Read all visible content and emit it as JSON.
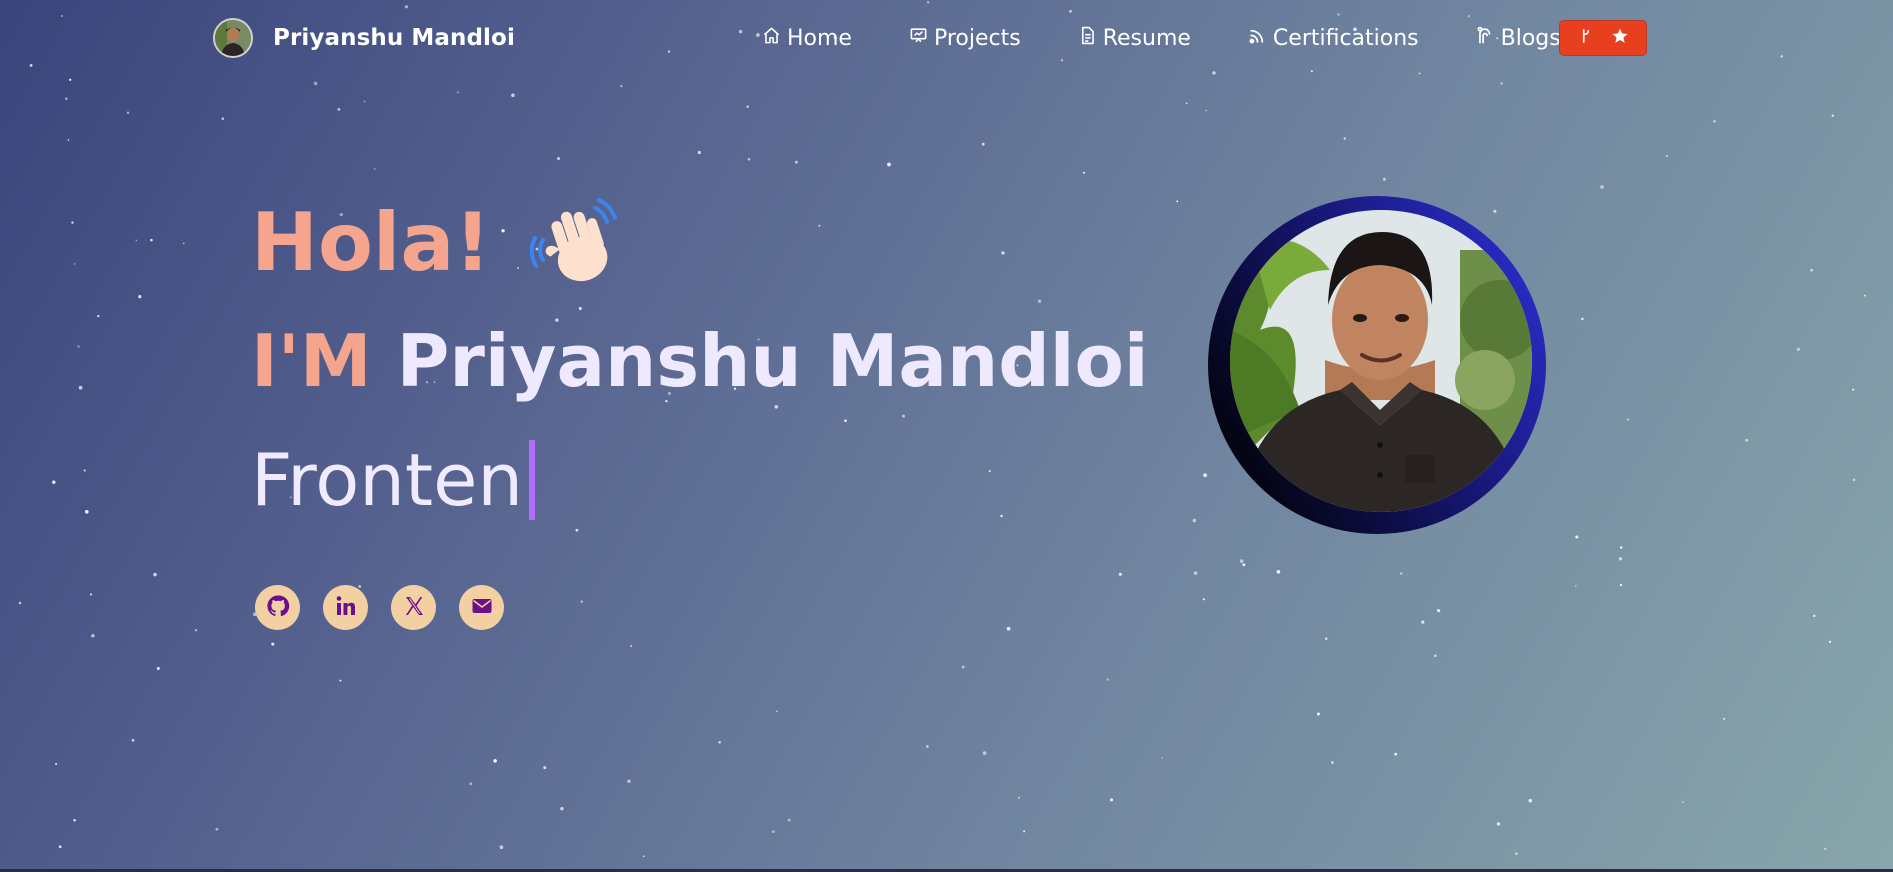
{
  "navbar": {
    "brand_name": "Priyanshu Mandloi",
    "links": [
      {
        "label": "Home",
        "icon": "home-icon"
      },
      {
        "label": "Projects",
        "icon": "presentation-icon"
      },
      {
        "label": "Resume",
        "icon": "document-icon"
      },
      {
        "label": "Certifications",
        "icon": "signal-icon"
      },
      {
        "label": "Blogs",
        "icon": "feed-icon"
      }
    ],
    "github_button": {
      "icons": [
        "fork-icon",
        "star-icon"
      ],
      "color": "#e8401e"
    }
  },
  "hero": {
    "greeting": "Hola!",
    "greeting_emoji": "waving-hand-icon",
    "intro_label": "I'M",
    "name": "Priyanshu Mandloi",
    "typed_text": "Fronten"
  },
  "socials": [
    {
      "name": "github-icon"
    },
    {
      "name": "linkedin-icon"
    },
    {
      "name": "x-twitter-icon"
    },
    {
      "name": "mail-icon"
    }
  ],
  "colors": {
    "accent": "#f5a58d",
    "name": "#eee9ff",
    "cursor": "#b46cff",
    "social_bg": "#f3d0a2",
    "social_icon": "#6b0f8a",
    "button": "#e8401e"
  }
}
